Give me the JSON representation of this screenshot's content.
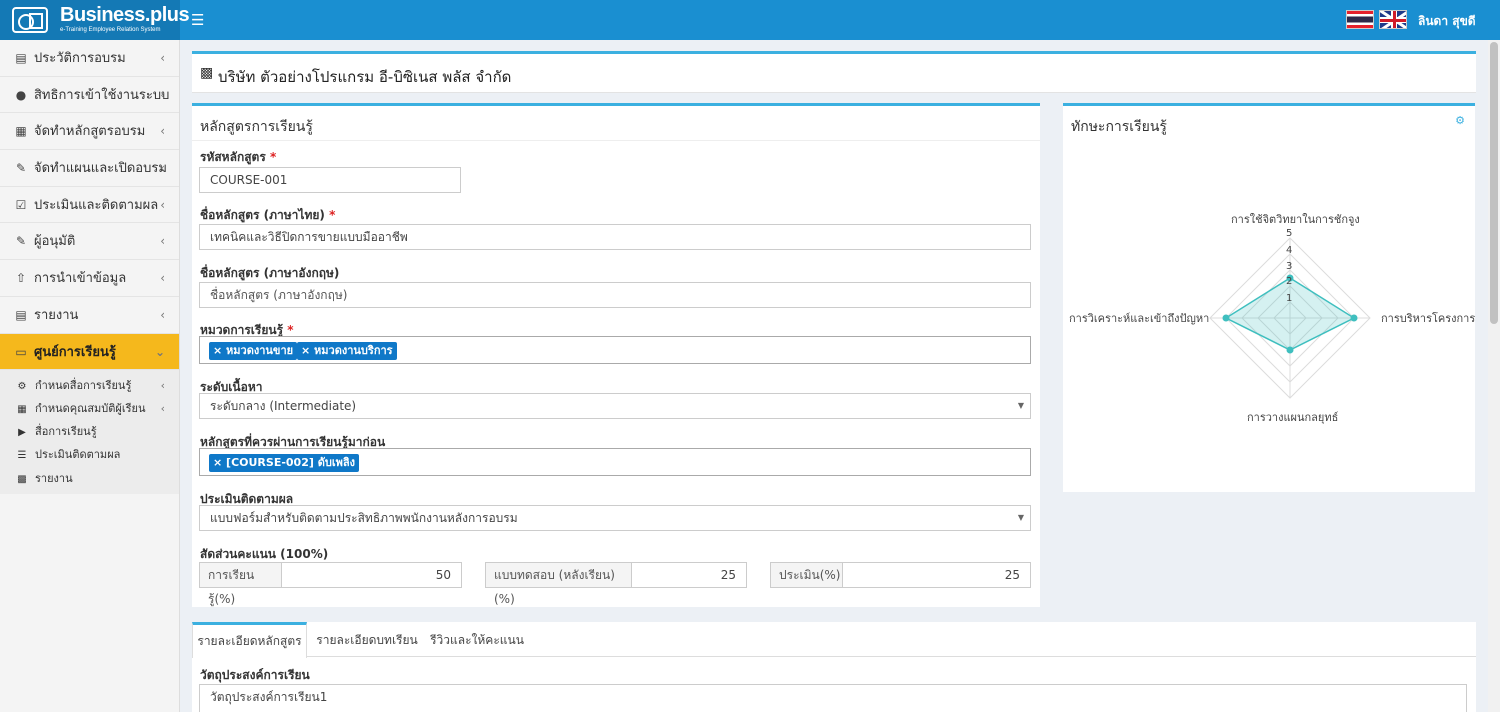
{
  "header": {
    "logo_title": "Business.plus",
    "logo_subtitle": "e-Training Employee Relation System",
    "user_name": "ลินดา สุขดี"
  },
  "sidebar": {
    "items": [
      {
        "label": "ประวัติการอบรม",
        "icon": "file-text-icon"
      },
      {
        "label": "สิทธิการเข้าใช้งานระบบ",
        "icon": "users-icon"
      },
      {
        "label": "จัดทำหลักสูตรอบรม",
        "icon": "book-icon"
      },
      {
        "label": "จัดทำแผนและเปิดอบรม",
        "icon": "edit-icon"
      },
      {
        "label": "ประเมินและติดตามผล",
        "icon": "check-square-icon"
      },
      {
        "label": "ผู้อนุมัติ",
        "icon": "edit-icon"
      },
      {
        "label": "การนำเข้าข้อมูล",
        "icon": "upload-icon"
      },
      {
        "label": "รายงาน",
        "icon": "pdf-icon"
      }
    ],
    "active": {
      "label": "ศูนย์การเรียนรู้",
      "icon": "monitor-icon"
    },
    "subitems": [
      {
        "label": "กำหนดสื่อการเรียนรู้",
        "icon": "gear-icon"
      },
      {
        "label": "กำหนดคุณสมบัติผู้เรียน",
        "icon": "book-icon"
      },
      {
        "label": "สื่อการเรียนรู้",
        "icon": "youtube-icon"
      },
      {
        "label": "ประเมินติดตามผล",
        "icon": "list-icon"
      },
      {
        "label": "รายงาน",
        "icon": "file-icon"
      }
    ]
  },
  "company": {
    "name": "บริษัท ตัวอย่างโปรแกรม อี-บิซิเนส พลัส จำกัด"
  },
  "course_panel": {
    "title": "หลักสูตรการเรียนรู้",
    "code_label": "รหัสหลักสูตร",
    "code_value": "COURSE-001",
    "name_th_label": "ชื่อหลักสูตร (ภาษาไทย)",
    "name_th_value": "เทคนิคและวิธีปิดการขายแบบมืออาชีพ",
    "name_en_label": "ชื่อหลักสูตร (ภาษาอังกฤษ)",
    "name_en_placeholder": "ชื่อหลักสูตร (ภาษาอังกฤษ)",
    "category_label": "หมวดการเรียนรู้",
    "category_tags": [
      "หมวดงานขาย",
      "หมวดงานบริการ"
    ],
    "level_label": "ระดับเนื้อหา",
    "level_value": "ระดับกลาง (Intermediate)",
    "prereq_label": "หลักสูตรที่ควรผ่านการเรียนรู้มาก่อน",
    "prereq_tags": [
      "[COURSE-002] ดับเพลิง"
    ],
    "eval_label": "ประเมินติดตามผล",
    "eval_value": "แบบฟอร์มสำหรับติดตามประสิทธิภาพพนักงานหลังการอบรม",
    "score_label": "สัดส่วนคะแนน (100%)",
    "scores": [
      {
        "label": "การเรียนรู้(%)",
        "value": "50"
      },
      {
        "label": "แบบทดสอบ (หลังเรียน)(%)",
        "value": "25"
      },
      {
        "label": "ประเมิน(%)",
        "value": "25"
      }
    ]
  },
  "skills_panel": {
    "title": "ทักษะการเรียนรู้",
    "chart_data": {
      "type": "radar",
      "axes": [
        "การใช้จิตวิทยาในการชักจูง",
        "การบริหารโครงการ",
        "การวางแผนกลยุทธ์",
        "การวิเคราะห์และเข้าถึงปัญหา"
      ],
      "values": [
        2.5,
        4,
        2,
        4
      ],
      "rlim": [
        0,
        5
      ],
      "ticks": [
        "1",
        "2",
        "3",
        "4",
        "5"
      ]
    }
  },
  "tabs": {
    "items": [
      "รายละเอียดหลักสูตร",
      "รายละเอียดบทเรียน",
      "รีวิวและให้คะแนน"
    ],
    "objective_label": "วัตถุประสงค์การเรียน",
    "objective_value": "วัตถุประสงค์การเรียน1"
  },
  "colors": {
    "primary": "#1a8fd1",
    "active_menu": "#f5b81c",
    "tag": "#0f78c8",
    "radar": "#3fbfbf"
  }
}
